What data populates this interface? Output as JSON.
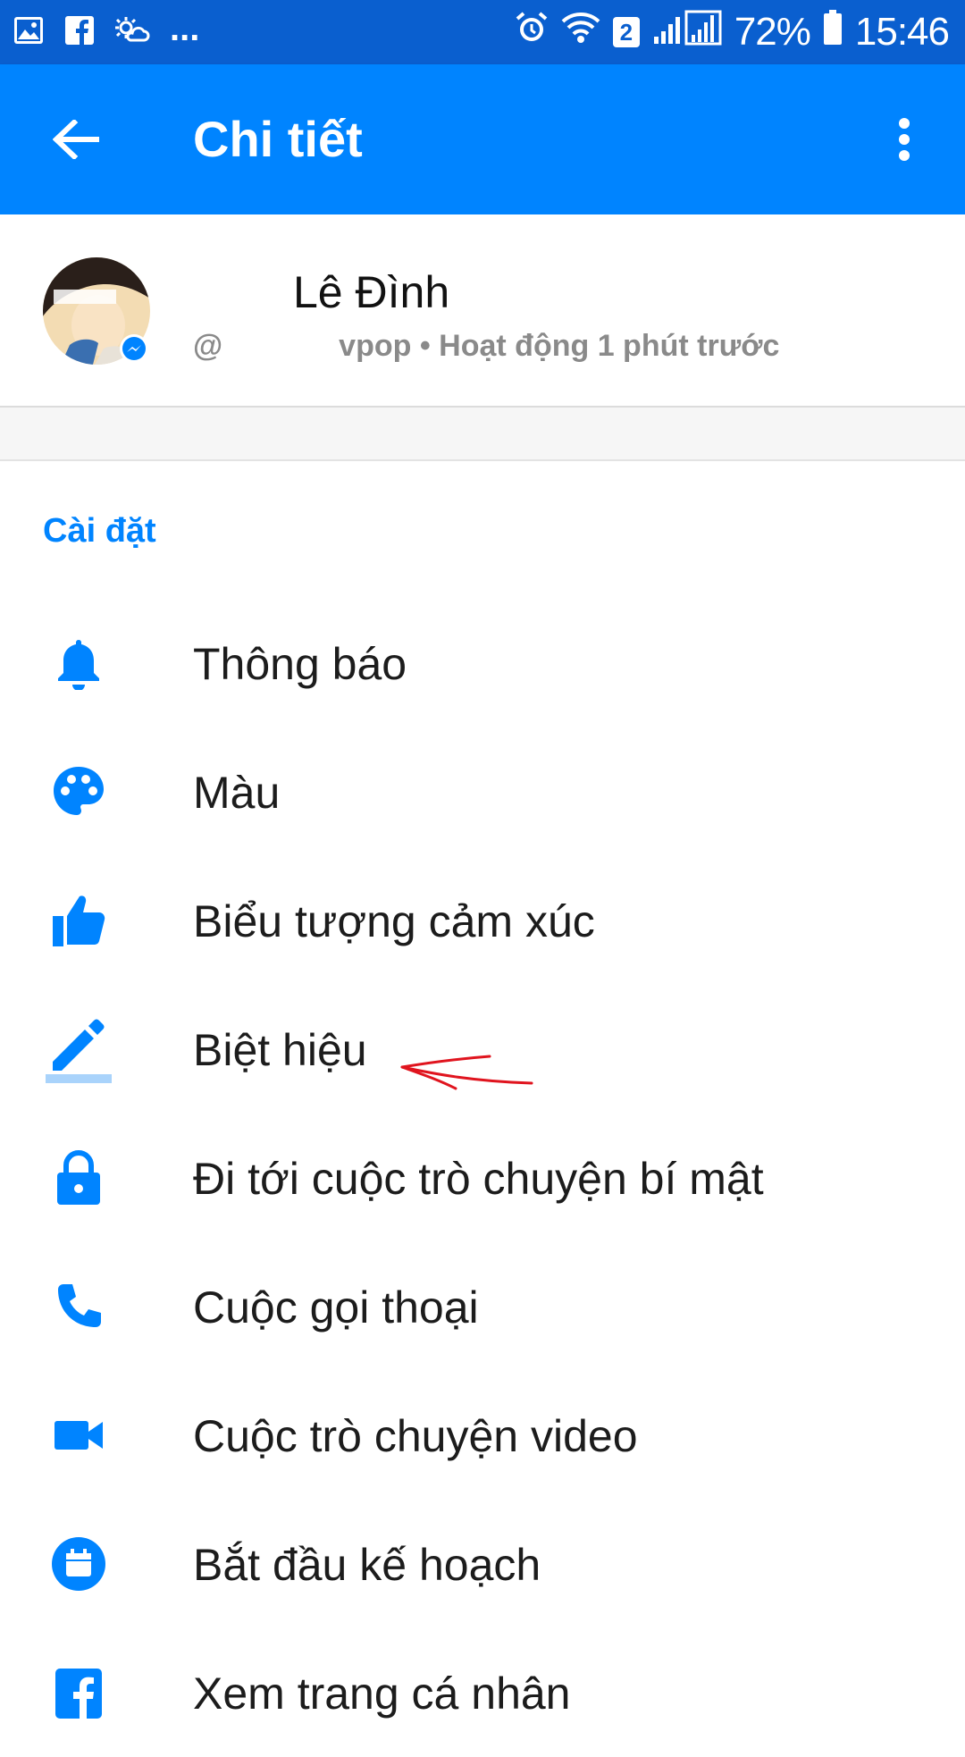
{
  "status_bar": {
    "notification_icons": [
      "gallery-icon",
      "facebook-icon",
      "weather-icon"
    ],
    "overflow": "...",
    "sim_number": "2",
    "battery_percent": "72%",
    "time": "15:46"
  },
  "app_bar": {
    "title": "Chi tiết"
  },
  "profile": {
    "name": "Lê Đình",
    "username_prefix": "@",
    "username_suffix": "vpop",
    "activity": "• Hoạt động 1 phút trước"
  },
  "settings": {
    "section_title": "Cài đặt",
    "items": [
      {
        "label": "Thông báo",
        "icon": "bell-icon"
      },
      {
        "label": "Màu",
        "icon": "palette-icon"
      },
      {
        "label": "Biểu tượng cảm xúc",
        "icon": "thumbs-up-icon"
      },
      {
        "label": "Biệt hiệu",
        "icon": "pencil-icon"
      },
      {
        "label": "Đi tới cuộc trò chuyện bí mật",
        "icon": "lock-icon"
      },
      {
        "label": "Cuộc gọi thoại",
        "icon": "phone-icon"
      },
      {
        "label": "Cuộc trò chuyện video",
        "icon": "video-camera-icon"
      },
      {
        "label": "Bắt đầu kế hoạch",
        "icon": "calendar-icon"
      },
      {
        "label": "Xem trang cá nhân",
        "icon": "facebook-icon"
      }
    ]
  },
  "colors": {
    "status_bar": "#0a5fcf",
    "app_bar": "#0084ff",
    "accent": "#0084ff",
    "annotation": "#e0141e"
  }
}
